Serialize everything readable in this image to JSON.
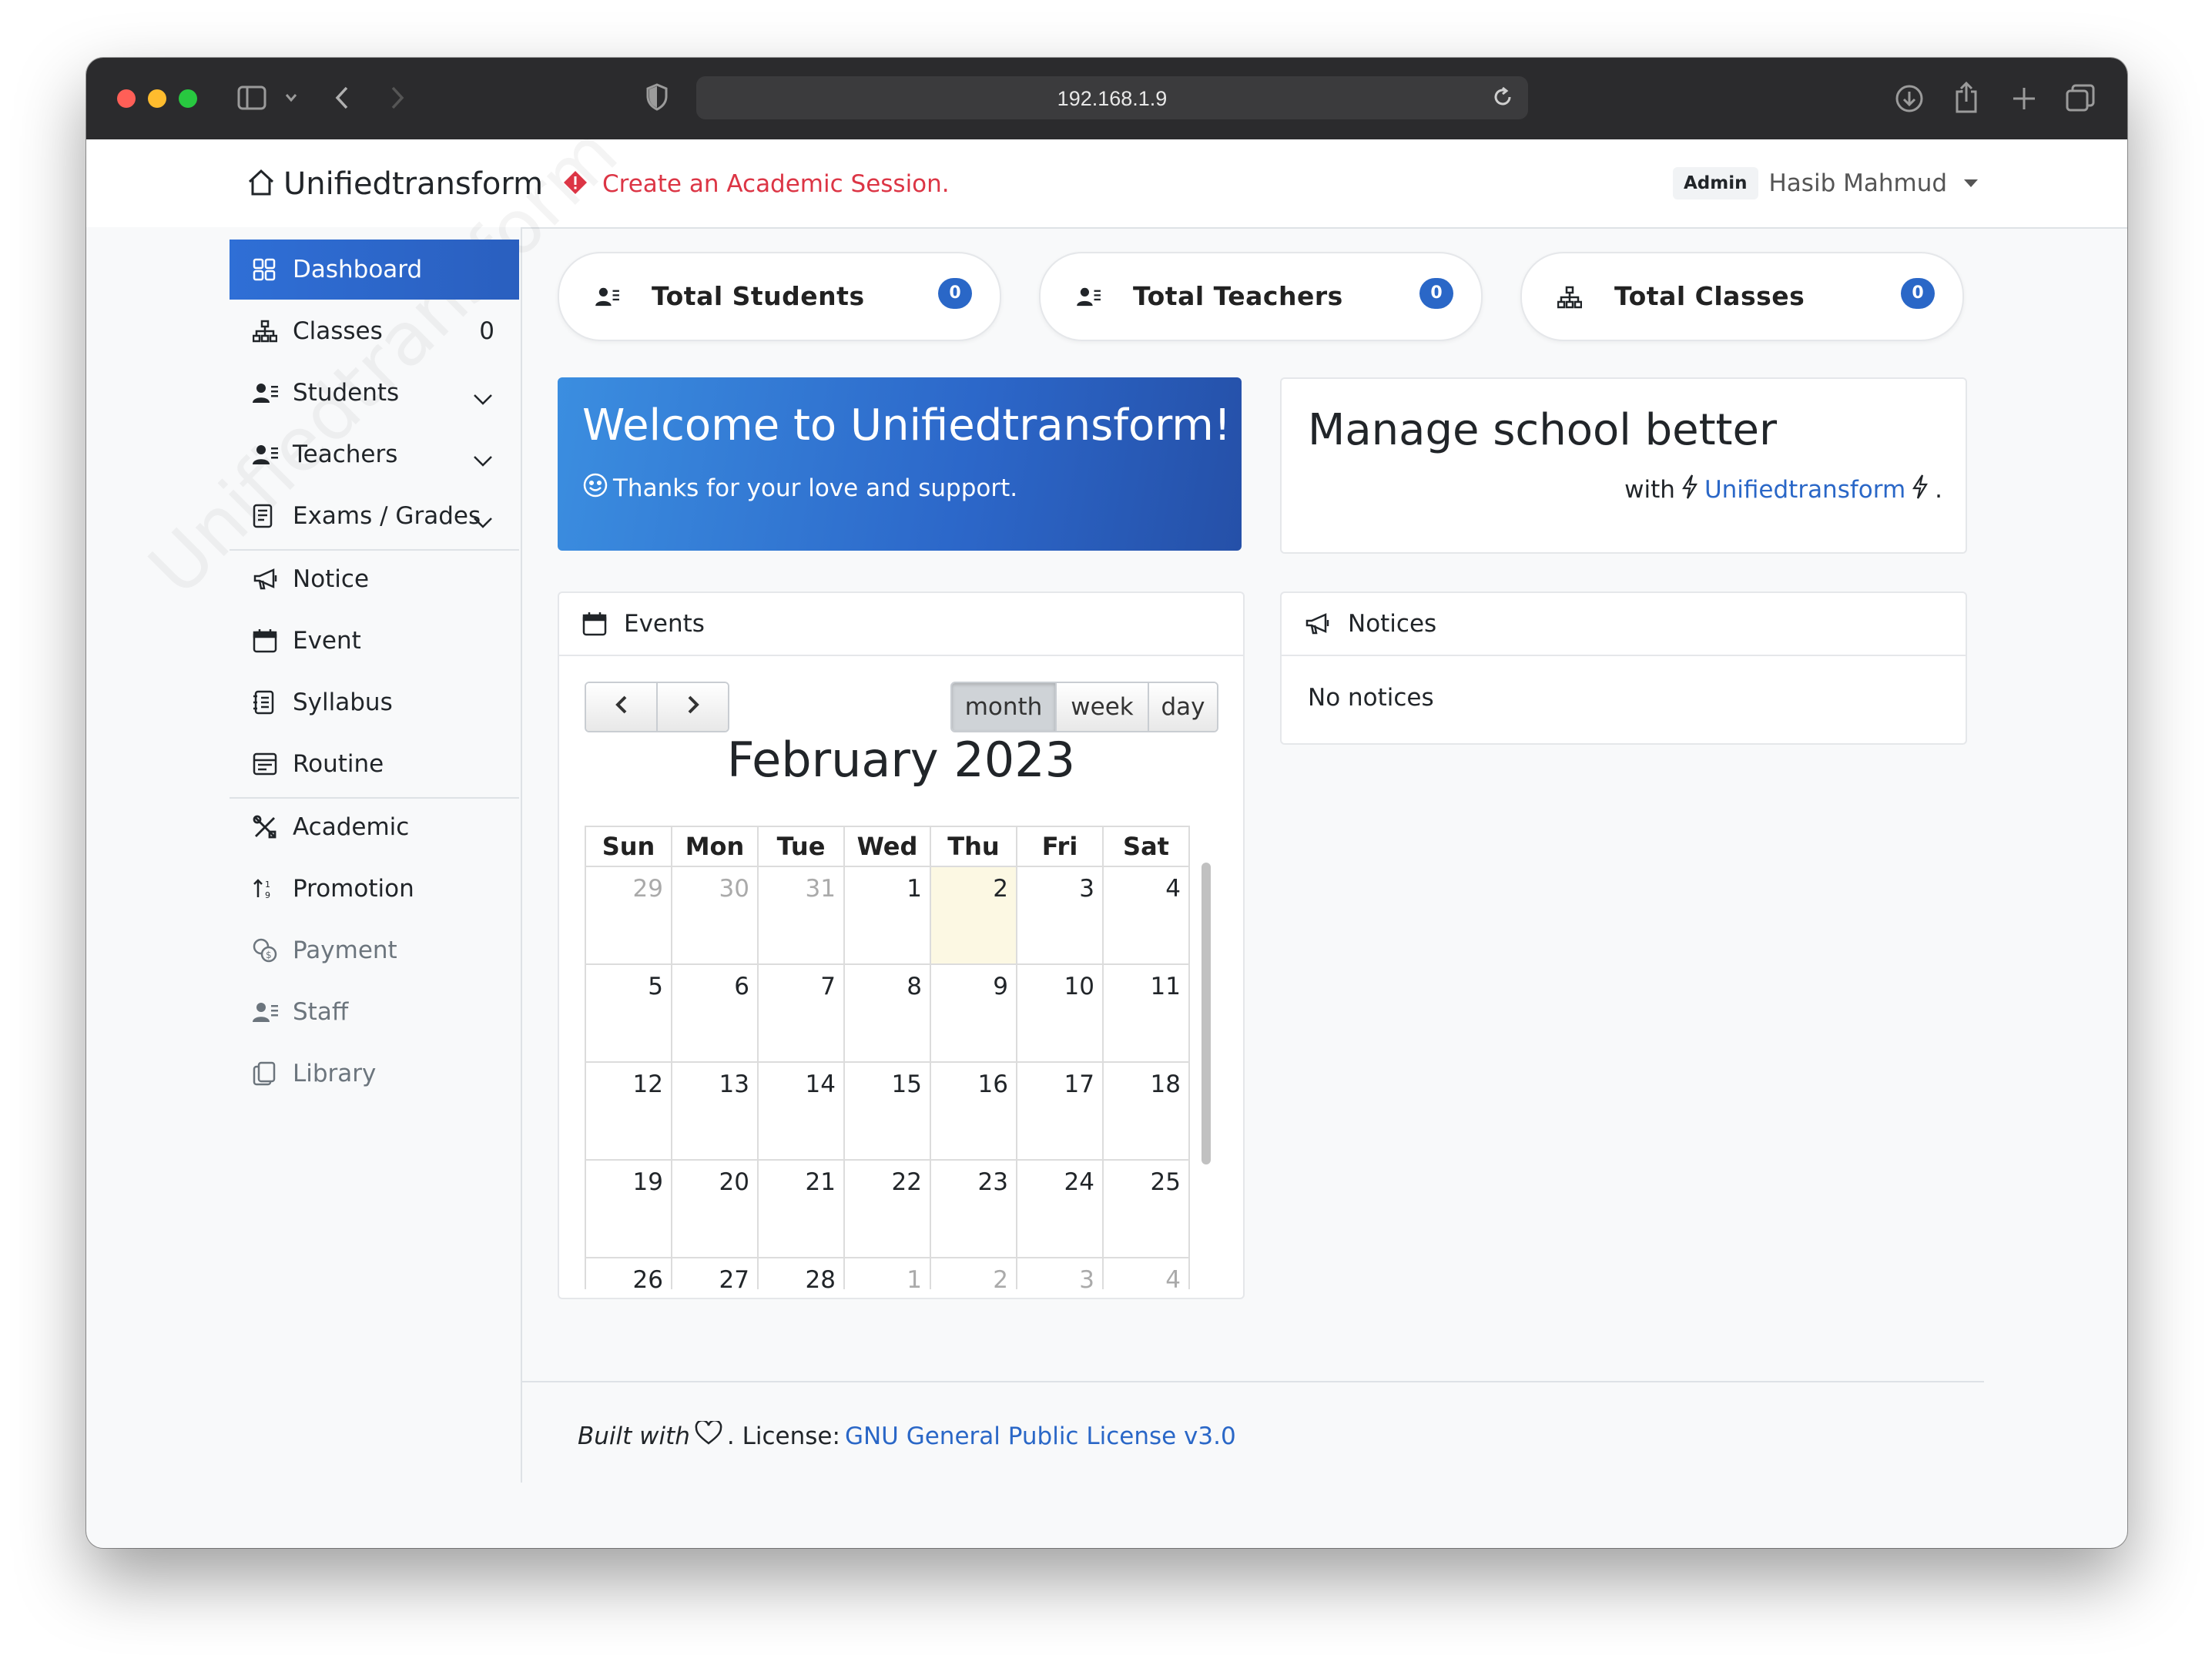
{
  "browser": {
    "url": "192.168.1.9"
  },
  "header": {
    "brand": "Unifiedtransform",
    "alert": "Create an Academic Session.",
    "role": "Admin",
    "user_name": "Hasib Mahmud"
  },
  "sidebar": {
    "watermark": "Unifiedtransform",
    "items": [
      {
        "label": "Dashboard",
        "icon": "grid-icon"
      },
      {
        "label": "Classes",
        "icon": "diagram-icon",
        "count": "0"
      },
      {
        "label": "Students",
        "icon": "person-lines-icon"
      },
      {
        "label": "Teachers",
        "icon": "person-lines-icon"
      },
      {
        "label": "Exams / Grades",
        "icon": "file-text-icon"
      },
      {
        "label": "Notice",
        "icon": "megaphone-icon"
      },
      {
        "label": "Event",
        "icon": "calendar-icon"
      },
      {
        "label": "Syllabus",
        "icon": "journal-icon"
      },
      {
        "label": "Routine",
        "icon": "calendar-table-icon"
      },
      {
        "label": "Academic",
        "icon": "tools-icon"
      },
      {
        "label": "Promotion",
        "icon": "sort-icon"
      },
      {
        "label": "Payment",
        "icon": "coins-icon"
      },
      {
        "label": "Staff",
        "icon": "person-lines-icon"
      },
      {
        "label": "Library",
        "icon": "files-icon"
      }
    ]
  },
  "stats": [
    {
      "label": "Total Students",
      "count": "0"
    },
    {
      "label": "Total Teachers",
      "count": "0"
    },
    {
      "label": "Total Classes",
      "count": "0"
    }
  ],
  "welcome": {
    "title": "Welcome to Unifiedtransform!",
    "subtitle": "Thanks for your love and support."
  },
  "manage": {
    "title": "Manage school better",
    "with": "with",
    "brand": "Unifiedtransform",
    "period": "."
  },
  "events": {
    "title": "Events",
    "views": [
      "month",
      "week",
      "day"
    ],
    "active_view": "month",
    "month_title": "February 2023",
    "weekdays": [
      "Sun",
      "Mon",
      "Tue",
      "Wed",
      "Thu",
      "Fri",
      "Sat"
    ],
    "weeks": [
      [
        "29",
        "30",
        "31",
        "1",
        "2",
        "3",
        "4"
      ],
      [
        "5",
        "6",
        "7",
        "8",
        "9",
        "10",
        "11"
      ],
      [
        "12",
        "13",
        "14",
        "15",
        "16",
        "17",
        "18"
      ],
      [
        "19",
        "20",
        "21",
        "22",
        "23",
        "24",
        "25"
      ],
      [
        "26",
        "27",
        "28",
        "1",
        "2",
        "3",
        "4"
      ]
    ],
    "today": "2"
  },
  "notices": {
    "title": "Notices",
    "empty": "No notices"
  },
  "footer": {
    "built_with": "Built with",
    "license_prefix": ". License:",
    "license_link": "GNU General Public License v3.0"
  }
}
